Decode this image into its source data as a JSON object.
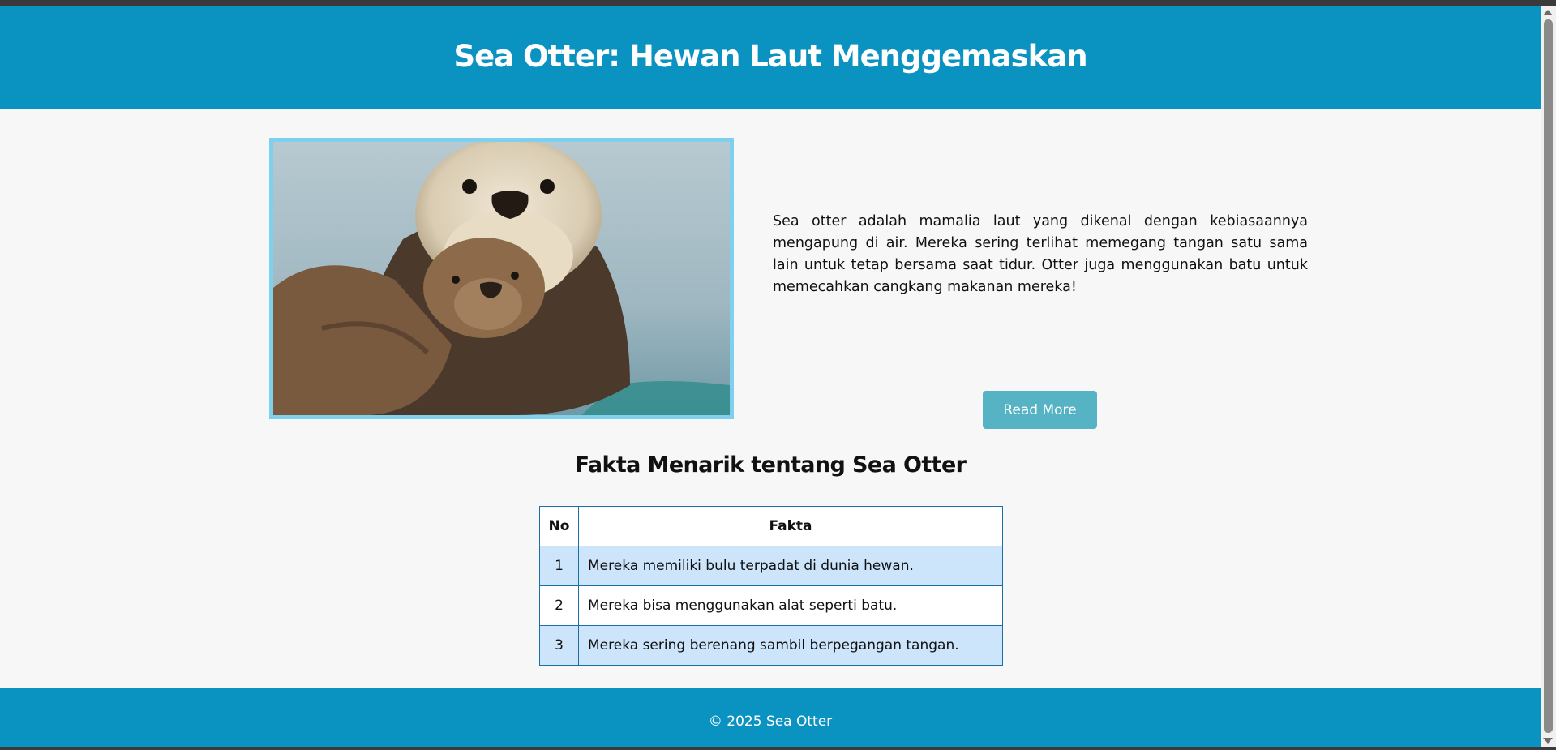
{
  "header": {
    "title": "Sea Otter: Hewan Laut Menggemaskan"
  },
  "intro": {
    "paragraph": "Sea otter adalah mamalia laut yang dikenal dengan kebiasaannya mengapung di air. Mereka sering terlihat memegang tangan satu sama lain untuk tetap bersama saat tidur. Otter juga menggunakan batu untuk memecahkan cangkang makanan mereka!",
    "read_more_label": "Read More"
  },
  "facts": {
    "heading": "Fakta Menarik tentang Sea Otter",
    "columns": [
      "No",
      "Fakta"
    ],
    "rows": [
      {
        "no": "1",
        "fact": "Mereka memiliki bulu terpadat di dunia hewan."
      },
      {
        "no": "2",
        "fact": "Mereka bisa menggunakan alat seperti batu."
      },
      {
        "no": "3",
        "fact": "Mereka sering berenang sambil berpegangan tangan."
      }
    ]
  },
  "footer": {
    "text": "© 2025 Sea Otter"
  },
  "colors": {
    "header_bg": "#0a92c1",
    "button_bg": "#55b3c4",
    "image_border": "#7fd0ee",
    "table_alt_row": "#cce5fb",
    "table_border": "#1a6fa5"
  }
}
